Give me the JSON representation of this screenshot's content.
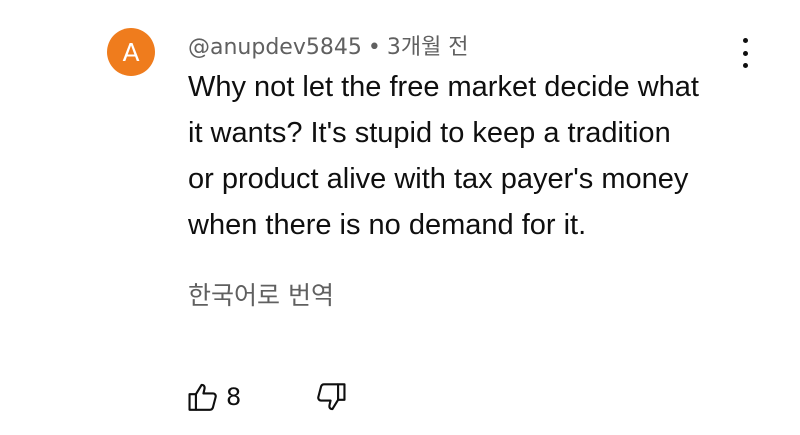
{
  "comment": {
    "avatar_letter": "A",
    "avatar_color": "#ef7c1d",
    "author": "@anupdev5845",
    "separator": "•",
    "time": "3개월 전",
    "lines": [
      "Why not let the free market decide what",
      "it wants? It's stupid to keep a tradition",
      "or product alive with tax payer's money",
      "when there is no demand for it."
    ],
    "translate_label": "한국어로 번역",
    "like_count": "8",
    "icons": {
      "menu": "more-vertical-icon",
      "like": "thumbs-up-icon",
      "dislike": "thumbs-down-icon"
    }
  }
}
